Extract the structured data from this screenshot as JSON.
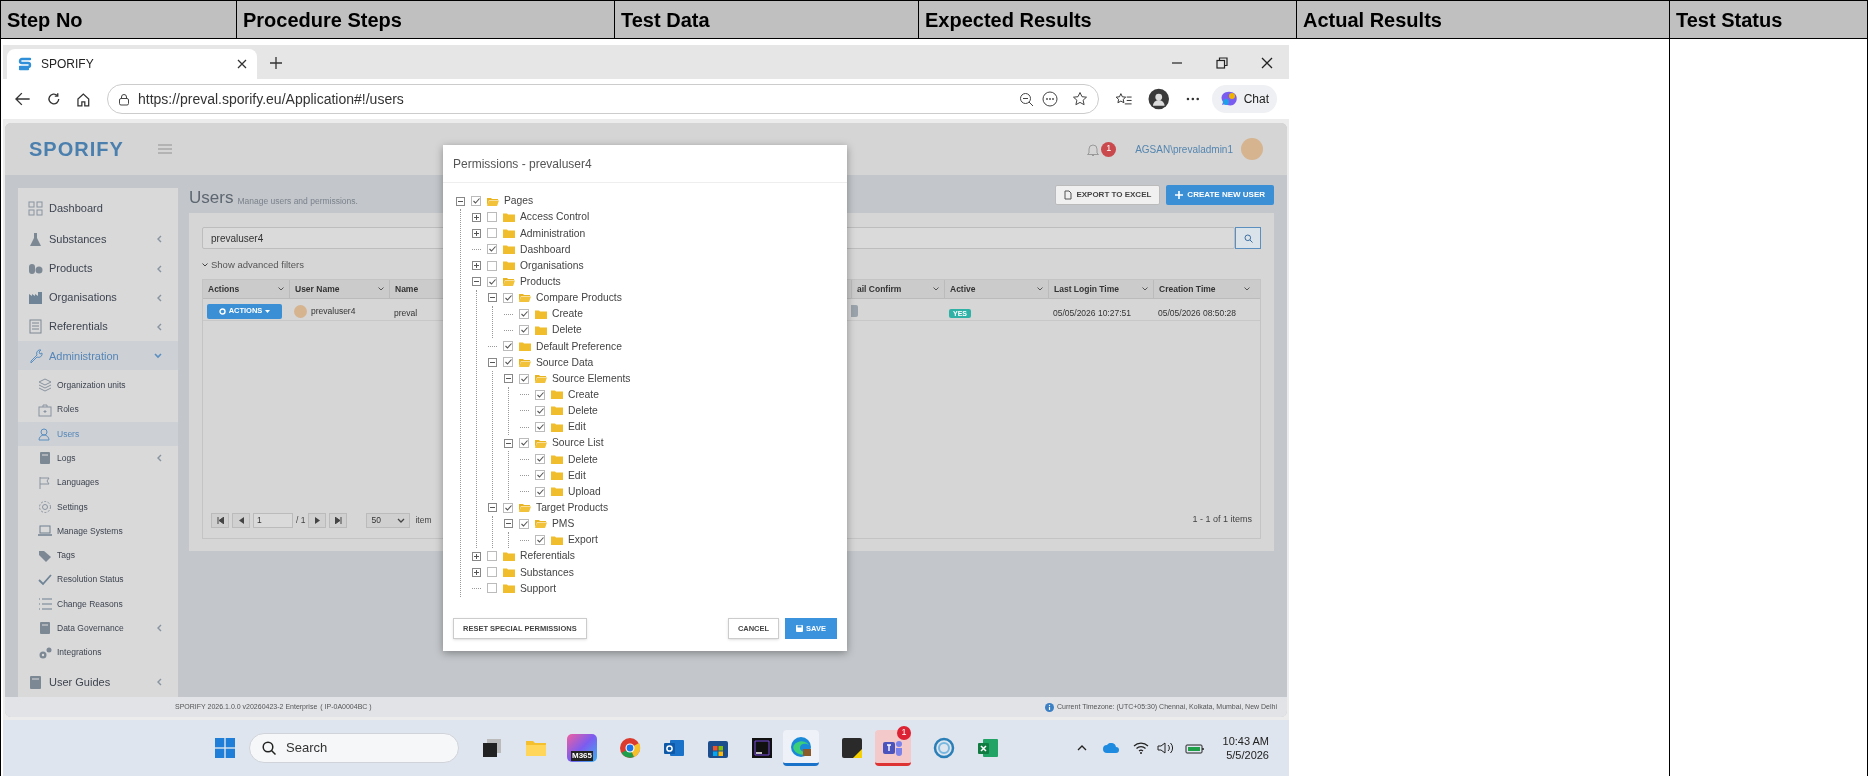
{
  "doc_table": {
    "columns": [
      "Step No",
      "Procedure Steps",
      "Test Data",
      "Expected Results",
      "Actual Results",
      "Test Status"
    ]
  },
  "browser": {
    "tab_title": "SPORIFY",
    "url": "https://preval.sporify.eu/Application#!/users",
    "chat_label": "Chat"
  },
  "app": {
    "logo": "SPORIFY",
    "notification_count": "1",
    "user": "AGSAN\\prevaladmin1",
    "sidebar": {
      "items": [
        {
          "label": "Dashboard",
          "kind": "link",
          "selected": false
        },
        {
          "label": "Substances",
          "kind": "group",
          "expanded": false,
          "selected": false
        },
        {
          "label": "Products",
          "kind": "group",
          "expanded": false,
          "selected": false
        },
        {
          "label": "Organisations",
          "kind": "group",
          "expanded": false,
          "selected": false
        },
        {
          "label": "Referentials",
          "kind": "group",
          "expanded": false,
          "selected": false
        },
        {
          "label": "Administration",
          "kind": "group",
          "expanded": true,
          "selected": false,
          "children": [
            {
              "label": "Organization units",
              "kind": "link",
              "selected": false
            },
            {
              "label": "Roles",
              "kind": "link",
              "selected": false
            },
            {
              "label": "Users",
              "kind": "link",
              "selected": true
            },
            {
              "label": "Logs",
              "kind": "group",
              "expanded": false,
              "selected": false
            },
            {
              "label": "Languages",
              "kind": "link",
              "selected": false
            },
            {
              "label": "Settings",
              "kind": "link",
              "selected": false
            },
            {
              "label": "Manage Systems",
              "kind": "link",
              "selected": false
            },
            {
              "label": "Tags",
              "kind": "link",
              "selected": false
            },
            {
              "label": "Resolution Status",
              "kind": "link",
              "selected": false
            },
            {
              "label": "Change Reasons",
              "kind": "link",
              "selected": false
            },
            {
              "label": "Data Governance",
              "kind": "group",
              "expanded": false,
              "selected": false
            },
            {
              "label": "Integrations",
              "kind": "link",
              "selected": false
            }
          ]
        },
        {
          "label": "User Guides",
          "kind": "group",
          "expanded": false,
          "selected": false
        }
      ]
    },
    "page": {
      "title": "Users",
      "subtitle": "Manage users and permissions.",
      "export_button": "EXPORT TO EXCEL",
      "create_button": "CREATE NEW USER",
      "search_value": "prevaluser4",
      "advanced_filters": "Show advanced filters",
      "table": {
        "columns": [
          "Actions",
          "User Name",
          "Name",
          "ail Confirm",
          "Active",
          "Last Login Time",
          "Creation Time"
        ],
        "rows": [
          {
            "actions_button": "ACTIONS",
            "user_name": "prevaluser4",
            "name": "preval",
            "active": "YES",
            "last_login": "05/05/2026 10:27:51",
            "creation_time": "05/05/2026 08:50:28"
          }
        ]
      },
      "pager": {
        "page": "1",
        "total": "/ 1",
        "page_size": "50",
        "page_size_suffix": "item",
        "summary": "1 - 1 of 1 items"
      }
    },
    "footer": {
      "version": "SPORIFY 2026.1.0.0 v20260423-2 Enterprise",
      "ip": "( IP-0A0004BC )",
      "timezone": "Current Timezone: (UTC+05:30) Chennai, Kolkata, Mumbai, New Delhi"
    },
    "dialog": {
      "title": "Permissions - prevaluser4",
      "tree": [
        {
          "label": "Pages",
          "kind": "folder",
          "expanded": true,
          "checked": true,
          "children": [
            {
              "label": "Access Control",
              "kind": "folder",
              "expanded": false,
              "checked": false
            },
            {
              "label": "Administration",
              "kind": "folder",
              "expanded": false,
              "checked": false
            },
            {
              "label": "Dashboard",
              "kind": "leaf",
              "checked": true
            },
            {
              "label": "Organisations",
              "kind": "folder",
              "expanded": false,
              "checked": false
            },
            {
              "label": "Products",
              "kind": "folder",
              "expanded": true,
              "checked": true,
              "children": [
                {
                  "label": "Compare Products",
                  "kind": "folder",
                  "expanded": true,
                  "checked": true,
                  "children": [
                    {
                      "label": "Create",
                      "kind": "leaf",
                      "checked": true
                    },
                    {
                      "label": "Delete",
                      "kind": "leaf",
                      "checked": true
                    }
                  ]
                },
                {
                  "label": "Default Preference",
                  "kind": "leaf",
                  "checked": true
                },
                {
                  "label": "Source Data",
                  "kind": "folder",
                  "expanded": true,
                  "checked": true,
                  "children": [
                    {
                      "label": "Source Elements",
                      "kind": "folder",
                      "expanded": true,
                      "checked": true,
                      "children": [
                        {
                          "label": "Create",
                          "kind": "leaf",
                          "checked": true
                        },
                        {
                          "label": "Delete",
                          "kind": "leaf",
                          "checked": true
                        },
                        {
                          "label": "Edit",
                          "kind": "leaf",
                          "checked": true
                        }
                      ]
                    },
                    {
                      "label": "Source List",
                      "kind": "folder",
                      "expanded": true,
                      "checked": true,
                      "children": [
                        {
                          "label": "Delete",
                          "kind": "leaf",
                          "checked": true
                        },
                        {
                          "label": "Edit",
                          "kind": "leaf",
                          "checked": true
                        },
                        {
                          "label": "Upload",
                          "kind": "leaf",
                          "checked": true
                        }
                      ]
                    }
                  ]
                },
                {
                  "label": "Target Products",
                  "kind": "folder",
                  "expanded": true,
                  "checked": true,
                  "children": [
                    {
                      "label": "PMS",
                      "kind": "folder",
                      "expanded": true,
                      "checked": true,
                      "children": [
                        {
                          "label": "Export",
                          "kind": "leaf",
                          "checked": true
                        }
                      ]
                    }
                  ]
                }
              ]
            },
            {
              "label": "Referentials",
              "kind": "folder",
              "expanded": false,
              "checked": false
            },
            {
              "label": "Substances",
              "kind": "folder",
              "expanded": false,
              "checked": false
            },
            {
              "label": "Support",
              "kind": "leaf",
              "checked": false
            }
          ]
        }
      ],
      "reset_button": "RESET SPECIAL PERMISSIONS",
      "cancel_button": "CANCEL",
      "save_button": "SAVE"
    }
  },
  "taskbar": {
    "search_placeholder": "Search",
    "m365_label": "M365",
    "teams_badge": "1",
    "time": "10:43 AM",
    "date": "5/5/2026"
  }
}
